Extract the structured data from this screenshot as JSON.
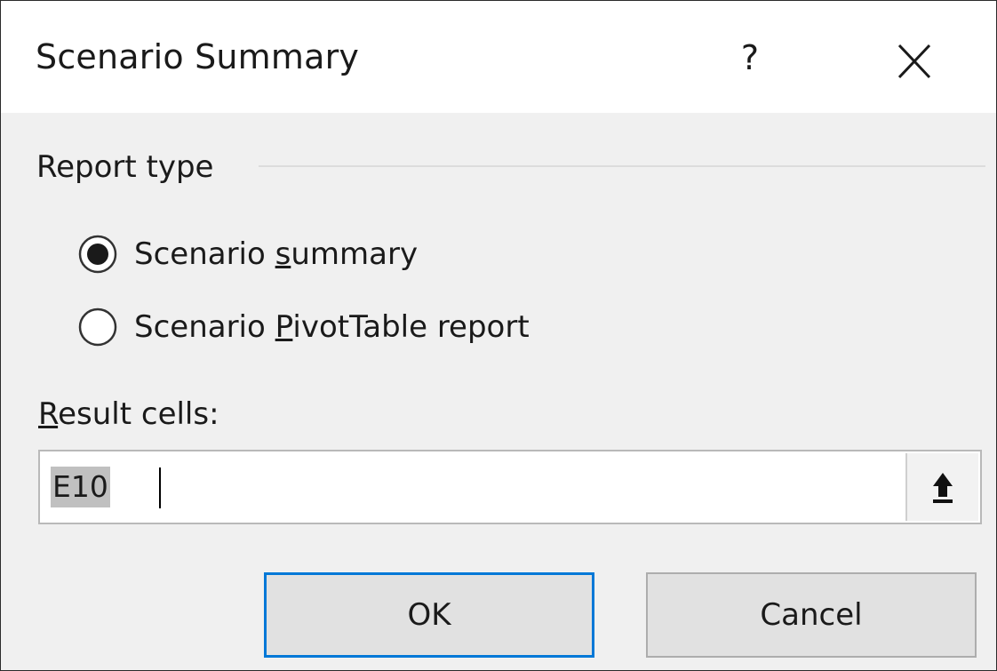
{
  "dialog": {
    "title": "Scenario Summary",
    "help_label": "?",
    "close_icon": "close-icon"
  },
  "report_type": {
    "group_title": "Report type",
    "options": [
      {
        "label_pre": "Scenario ",
        "label_mnemonic": "s",
        "label_post": "ummary",
        "selected": true
      },
      {
        "label_pre": "Scenario ",
        "label_mnemonic": "P",
        "label_post": "ivotTable report",
        "selected": false
      }
    ]
  },
  "result_cells": {
    "label_mnemonic": "R",
    "label_rest": "esult cells:",
    "value": "E10",
    "collapse_icon": "upload-arrow-icon"
  },
  "buttons": {
    "ok_label": "OK",
    "cancel_label": "Cancel"
  },
  "colors": {
    "accent": "#0078d7",
    "dialog_bg": "#f0f0f0",
    "titlebar_bg": "#ffffff"
  }
}
